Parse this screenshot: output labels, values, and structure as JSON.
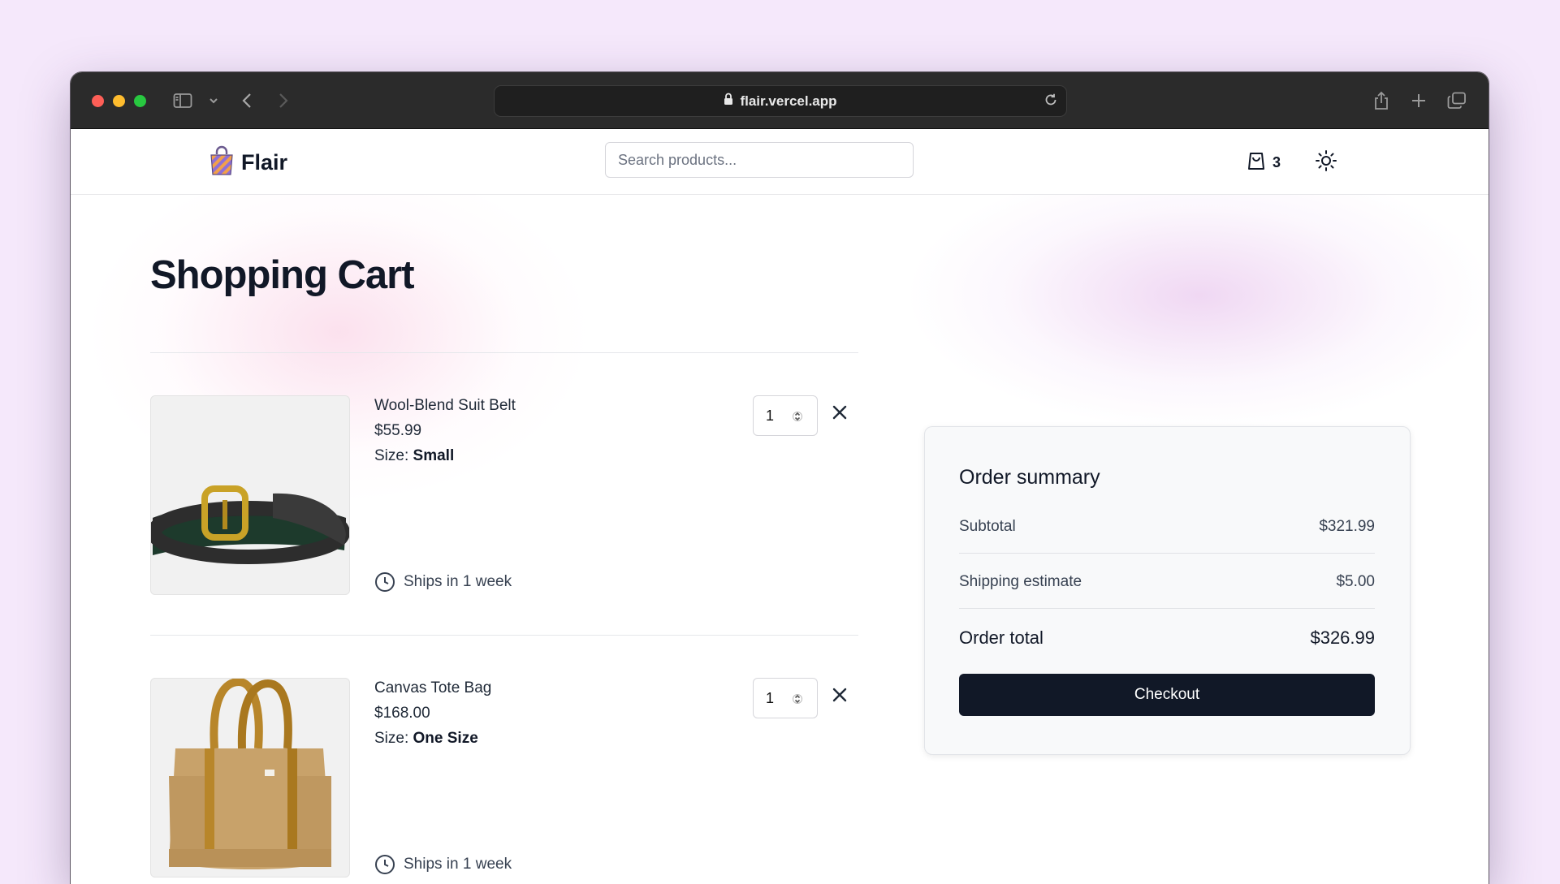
{
  "browser": {
    "url": "flair.vercel.app",
    "icons": [
      "sidebar-icon",
      "chevron-down-icon",
      "back-icon",
      "forward-icon",
      "lock-icon",
      "reload-icon",
      "share-icon",
      "new-tab-icon",
      "tabs-overview-icon"
    ]
  },
  "header": {
    "brand": "Flair",
    "search_placeholder": "Search products...",
    "cart_count": "3",
    "icons": [
      "shopping-bag-logo-icon",
      "cart-icon",
      "sun-icon"
    ]
  },
  "page": {
    "title": "Shopping Cart"
  },
  "cart": {
    "items": [
      {
        "name": "Wool-Blend Suit Belt",
        "price": "$55.99",
        "size_label": "Size:",
        "size_value": "Small",
        "quantity": "1",
        "shipping": "Ships in 1 week",
        "image": "belt"
      },
      {
        "name": "Canvas Tote Bag",
        "price": "$168.00",
        "size_label": "Size:",
        "size_value": "One Size",
        "quantity": "1",
        "shipping": "Ships in 1 week",
        "image": "tote-bag"
      }
    ]
  },
  "summary": {
    "title": "Order summary",
    "subtotal_label": "Subtotal",
    "subtotal_value": "$321.99",
    "shipping_label": "Shipping estimate",
    "shipping_value": "$5.00",
    "total_label": "Order total",
    "total_value": "$326.99",
    "checkout_label": "Checkout"
  },
  "colors": {
    "accent": "#111827",
    "page_background": "#f5e8fb",
    "titlebar": "#2b2b2b"
  }
}
